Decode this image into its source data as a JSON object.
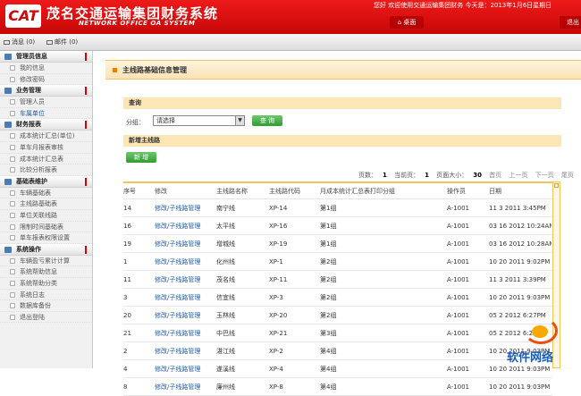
{
  "header": {
    "logo_text": "CAT",
    "brand_cn": "茂名交通运输集团财务系统",
    "brand_en": "NETWORK OFFICE OA SYSTEM",
    "welcome": "您好 欢迎使用交通运输集团财务   今天是：2013年1月6日星期日",
    "desktop_button": "桌面",
    "exit_button": "退出"
  },
  "subbar": {
    "messages": "消息 (0)",
    "mail": "邮件 (0)"
  },
  "sidebar": {
    "sections": [
      {
        "title": "管理员信息",
        "items": [
          "我的信息",
          "修改密码"
        ]
      },
      {
        "title": "业务管理",
        "items": [
          "管理人员",
          "车属单位"
        ]
      },
      {
        "title": "财务报表",
        "items": [
          "成本统计汇总(单位)",
          "单车月报表审核",
          "成本统计汇总表",
          "比较分析报表"
        ]
      },
      {
        "title": "基础表维护",
        "items": [
          "车辆基础表",
          "主线路基础表",
          "单位关联线路",
          "限制时间基础表",
          "单车报表权限设置"
        ]
      },
      {
        "title": "系统操作",
        "items": [
          "车辆盈亏累计计算",
          "系统帮助信息",
          "系统帮助分类",
          "系统日志",
          "数据库备份",
          "退出登陆"
        ]
      }
    ],
    "active_item": "车属单位"
  },
  "main": {
    "page_title": "主线路基础信息管理",
    "search_header": "查询",
    "category_label": "分组：",
    "category_value": "请选择",
    "query_button": "查 询",
    "add_header": "新增主线路",
    "add_button": "新 增",
    "pager": {
      "total_pages_label": "页数：",
      "total_pages": "1",
      "current_label": "当前页：",
      "current": "1",
      "size_label": "页面大小：",
      "size": "30",
      "first": "首页",
      "prev": "上一页",
      "next": "下一页",
      "last": "尾页"
    },
    "table": {
      "headers": [
        "序号",
        "修改",
        "主线路名称",
        "主线路代码",
        "月成本统计汇总表打印分组",
        "操作员",
        "日期"
      ],
      "rows": [
        [
          "14",
          "修改/子线路管理",
          "南宁线",
          "XP-14",
          "第1组",
          "A-1001",
          "11 3 2011 3:45PM"
        ],
        [
          "16",
          "修改/子线路管理",
          "太平线",
          "XP-16",
          "第1组",
          "A-1001",
          "03 16 2012 10:24AM"
        ],
        [
          "19",
          "修改/子线路管理",
          "增城线",
          "XP-19",
          "第1组",
          "A-1001",
          "03 16 2012 10:28AM"
        ],
        [
          "1",
          "修改/子线路管理",
          "化州线",
          "XP-1",
          "第2组",
          "A-1001",
          "10 20 2011 9:02PM"
        ],
        [
          "11",
          "修改/子线路管理",
          "茂名线",
          "XP-11",
          "第2组",
          "A-1001",
          "11 3 2011 3:39PM"
        ],
        [
          "3",
          "修改/子线路管理",
          "信宜线",
          "XP-3",
          "第2组",
          "A-1001",
          "10 20 2011 9:03PM"
        ],
        [
          "20",
          "修改/子线路管理",
          "玉林线",
          "XP-20",
          "第2组",
          "A-1001",
          "05 2 2012 6:27PM"
        ],
        [
          "21",
          "修改/子线路管理",
          "中巴线",
          "XP-21",
          "第3组",
          "A-1001",
          "05 2 2012 6:28PM"
        ],
        [
          "2",
          "修改/子线路管理",
          "湛江线",
          "XP-2",
          "第4组",
          "A-1001",
          "10 20 2011 9:03PM"
        ],
        [
          "4",
          "修改/子线路管理",
          "遂溪线",
          "XP-4",
          "第4组",
          "A-1001",
          "10 20 2011 9:03PM"
        ],
        [
          "8",
          "修改/子线路管理",
          "廉州线",
          "XP-8",
          "第4组",
          "A-1001",
          "10 20 2011 9:03PM"
        ]
      ]
    }
  },
  "watermark": {
    "text": "软件网络"
  }
}
